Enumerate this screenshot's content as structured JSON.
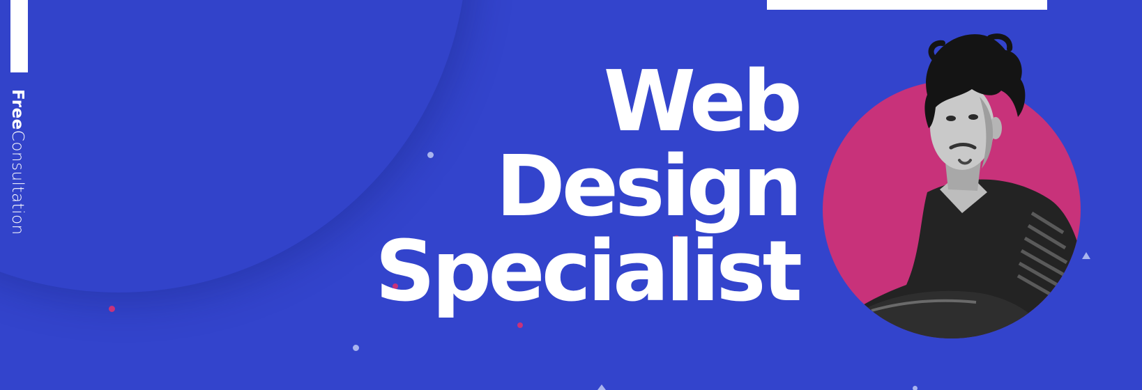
{
  "side_label": {
    "bold": "Free",
    "light": "Consultation"
  },
  "headline": {
    "line1": "Web",
    "line2": "Design",
    "line3": "Specialist"
  },
  "colors": {
    "background": "#3344cc",
    "accent_circle": "#c8327a",
    "text": "#ffffff"
  },
  "photo": {
    "icon": "person-portrait"
  }
}
